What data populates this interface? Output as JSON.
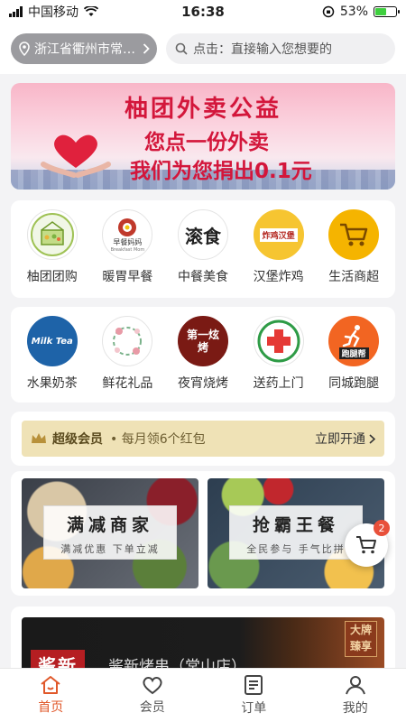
{
  "status_bar": {
    "carrier": "中国移动",
    "time": "16:38",
    "battery_percent": "53%",
    "battery_level": 0.53
  },
  "header": {
    "location": "浙江省衢州市常…",
    "search_placeholder": "点击：直接输入您想要的"
  },
  "banner": {
    "title": "柚团外卖公益",
    "line2": "您点一份外卖",
    "line3": "我们为您捐出0.1元"
  },
  "categories_row1": [
    {
      "label": "柚团团购"
    },
    {
      "label": "暖胃早餐"
    },
    {
      "label": "中餐美食"
    },
    {
      "label": "汉堡炸鸡"
    },
    {
      "label": "生活商超"
    }
  ],
  "categories_row2": [
    {
      "label": "水果奶茶"
    },
    {
      "label": "鲜花礼品"
    },
    {
      "label": "夜宵烧烤"
    },
    {
      "label": "送药上门"
    },
    {
      "label": "同城跑腿"
    }
  ],
  "icon_texts": {
    "breakfast": "早餐妈妈",
    "breakfast_en": "Breakfast Mom",
    "chinese_food": "滚食",
    "burger": "炸鸡汉堡",
    "milk_tea": "Milk Tea",
    "bbq": "第一炫烤",
    "errand": "跑腿帮"
  },
  "vip": {
    "title": "超级会员",
    "subtitle": "• 每月领6个红包",
    "action": "立即开通"
  },
  "promos": [
    {
      "title": "满减商家",
      "subtitle": "满减优惠 下单立减"
    },
    {
      "title": "抢霸王餐",
      "subtitle": "全民参与 手气比拼"
    }
  ],
  "cart": {
    "badge": "2"
  },
  "store": {
    "tag": "酱新",
    "name": "酱新烤串（常山店）",
    "badge": "大牌臻享"
  },
  "nav": [
    {
      "label": "首页",
      "icon": "home-icon"
    },
    {
      "label": "会员",
      "icon": "heart-icon"
    },
    {
      "label": "订单",
      "icon": "order-icon"
    },
    {
      "label": "我的",
      "icon": "profile-icon"
    }
  ],
  "colors": {
    "accent": "#e0582a",
    "banner_red": "#d3163b",
    "vip_bg": "#efe2b6"
  }
}
